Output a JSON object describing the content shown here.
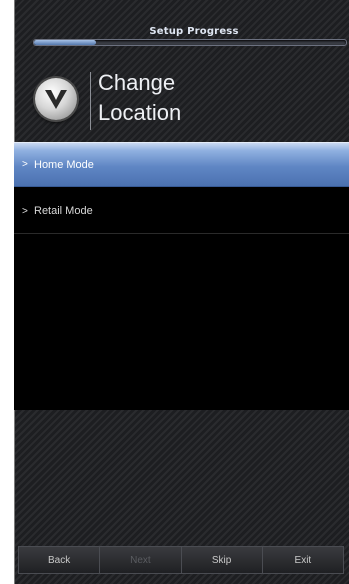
{
  "header": {
    "progress_title": "Setup Progress",
    "progress_fraction": 0.2
  },
  "title": {
    "line1": "Change",
    "line2": "Location"
  },
  "logo": {
    "icon": "vizio-v-logo-icon"
  },
  "menu": {
    "items": [
      {
        "label": "Home Mode",
        "selected": true
      },
      {
        "label": "Retail Mode",
        "selected": false
      }
    ]
  },
  "bottom_bar": {
    "back_label": "Back",
    "next_label": "Next",
    "skip_label": "Skip",
    "exit_label": "Exit"
  },
  "colors": {
    "selected_item": "#5f86c4",
    "background": "#1d1e21"
  }
}
